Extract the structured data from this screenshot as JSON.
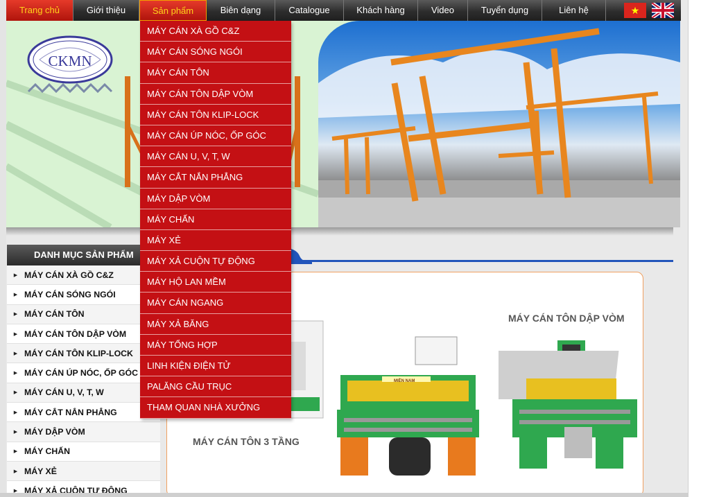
{
  "nav": {
    "items": [
      {
        "label": "Trang chủ",
        "state": "active"
      },
      {
        "label": "Giới thiệu",
        "state": ""
      },
      {
        "label": "Sản phẩm",
        "state": "open"
      },
      {
        "label": "Biên dạng",
        "state": ""
      },
      {
        "label": "Catalogue",
        "state": ""
      },
      {
        "label": "Khách hàng",
        "state": ""
      },
      {
        "label": "Video",
        "state": ""
      },
      {
        "label": "Tuyển dụng",
        "state": ""
      },
      {
        "label": "Liên hệ",
        "state": ""
      }
    ],
    "flags": [
      "vietnam-flag-icon",
      "uk-flag-icon"
    ],
    "flag_vn_star": "★"
  },
  "banner": {
    "logo_text": "CKMN"
  },
  "dropdown": {
    "items": [
      "MÁY CÁN XÀ GỒ C&Z",
      "MÁY CÁN SÓNG NGÓI",
      "MÁY CÁN TÔN",
      "MÁY CÁN TÔN DẬP VÒM",
      "MÁY CÁN TÔN KLIP-LOCK",
      "MÁY CÁN ÚP NÓC, ỐP GÓC",
      "MÁY CÁN U, V, T, W",
      "MÁY CẮT NẮN PHẲNG",
      "MÁY DẬP VÒM",
      "MÁY CHẤN",
      "MÁY XẺ",
      "MÁY XẢ CUỘN TỰ ĐỘNG",
      "MÁY HỘ LAN MỀM",
      "MÁY CÁN NGANG",
      "MÁY XẢ BĂNG",
      "MÁY TỔNG HỢP",
      "LINH KIỆN ĐIỆN TỬ",
      "PALĂNG CẦU TRỤC",
      "THAM QUAN NHÀ XƯỞNG"
    ]
  },
  "sidebar": {
    "title": "DANH MỤC SẢN PHẨM",
    "items": [
      "MÁY CÁN XÀ GỒ C&Z",
      "MÁY CÁN SÓNG NGÓI",
      "MÁY CÁN TÔN",
      "MÁY CÁN TÔN DẬP VÒM",
      "MÁY CÁN TÔN KLIP-LOCK",
      "MÁY CÁN ÚP NÓC, ỐP GÓC",
      "MÁY CÁN U, V, T, W",
      "MÁY CẮT NẮN PHẲNG",
      "MÁY DẬP VÒM",
      "MÁY CHẤN",
      "MÁY XẺ",
      "MÁY XẢ CUỘN TỰ ĐỘNG"
    ],
    "bullet": "▶"
  },
  "content": {
    "products": [
      {
        "label": "MÁY CÁN TÔN 3 TẦNG"
      },
      {
        "label": "MÁY CÁN TÔN DẬP VÒM"
      }
    ],
    "machine_nameplate": "MIỀN NAM"
  },
  "colors": {
    "accent_red": "#c41014",
    "nav_dark": "#2d2d2d",
    "active_text": "#ffd21a",
    "machine_green": "#2fa84f",
    "crane_orange": "#e8861e"
  }
}
